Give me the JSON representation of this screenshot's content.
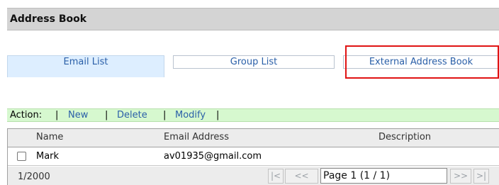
{
  "header": {
    "title": "Address Book"
  },
  "tabs": {
    "email_list": "Email List",
    "group_list": "Group List",
    "external_address_book": "External Address Book"
  },
  "action_bar": {
    "label": "Action:",
    "separator": "|",
    "new": "New",
    "delete": "Delete",
    "modify": "Modify"
  },
  "table": {
    "columns": {
      "name": "Name",
      "email": "Email Address",
      "description": "Description"
    },
    "rows": [
      {
        "name": "Mark",
        "email": "av01935@gmail.com",
        "description": ""
      }
    ]
  },
  "footer": {
    "count": "1/2000",
    "first": "|<",
    "prev": "<<",
    "page": "Page 1 (1 / 1)",
    "next": ">>",
    "last": ">|"
  },
  "colors": {
    "accent": "#2a5fa8",
    "highlight": "#e01414",
    "action_bar": "#d6f8cf",
    "active_tab": "#ddeeff"
  }
}
